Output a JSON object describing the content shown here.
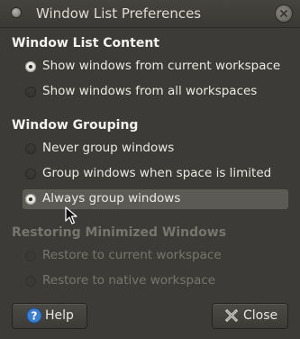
{
  "window": {
    "title": "Window List Preferences"
  },
  "sections": {
    "content": {
      "heading": "Window List Content",
      "options": [
        {
          "label": "Show windows from current workspace",
          "checked": true
        },
        {
          "label": "Show windows from all workspaces",
          "checked": false
        }
      ]
    },
    "grouping": {
      "heading": "Window Grouping",
      "options": [
        {
          "label": "Never group windows",
          "checked": false
        },
        {
          "label": "Group windows when space is limited",
          "checked": false
        },
        {
          "label": "Always group windows",
          "checked": true
        }
      ]
    },
    "restoring": {
      "heading": "Restoring Minimized Windows",
      "enabled": false,
      "options": [
        {
          "label": "Restore to current workspace",
          "checked": false
        },
        {
          "label": "Restore to native workspace",
          "checked": false
        }
      ]
    }
  },
  "buttons": {
    "help_label": "Help",
    "close_label": "Close"
  },
  "colors": {
    "window_bg": "#3c3b37",
    "hover_row": "#5b5a55",
    "help_icon_blue": "#3c7fcf",
    "disabled_text": "#77756f"
  },
  "icons": {
    "title": "window-menu-dot-icon",
    "close": "close-icon",
    "help": "help-icon",
    "close_button": "close-x-icon",
    "pointer": "mouse-pointer-icon"
  }
}
